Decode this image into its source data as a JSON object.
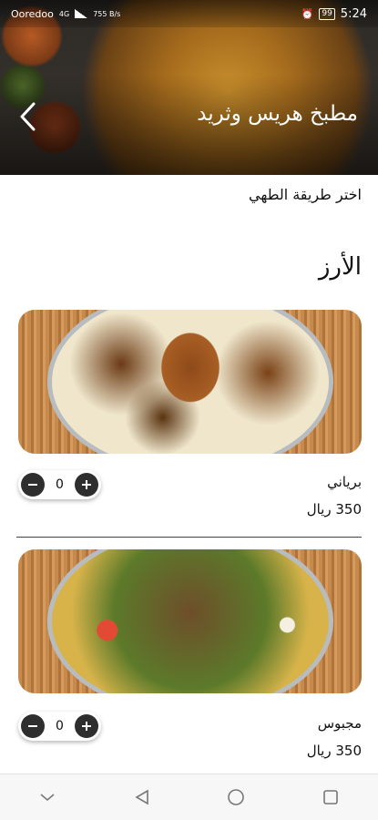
{
  "status_bar": {
    "carrier": "Ooredoo",
    "network": "4G",
    "speed": "755 B/s",
    "battery": "99",
    "time": "5:24"
  },
  "header": {
    "title": "مطبخ هريس وثريد",
    "back_icon": "chevron-left-icon"
  },
  "subtitle": "اختر طريقة الطهي",
  "section_title": "الأرز",
  "items": [
    {
      "name": "برياني",
      "price": "350 ريال",
      "quantity": "0"
    },
    {
      "name": "مجبوس",
      "price": "350 ريال",
      "quantity": "0"
    }
  ],
  "nav_bar": {
    "icons": [
      "collapse-chevron-icon",
      "back-triangle-icon",
      "home-circle-icon",
      "recents-square-icon"
    ]
  }
}
